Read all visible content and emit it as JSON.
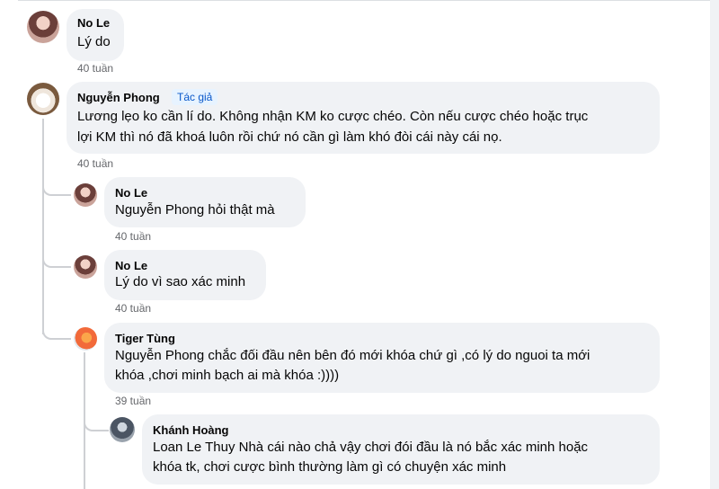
{
  "comments": [
    {
      "name": "No Le",
      "text": [
        "Lý do"
      ],
      "time": "40 tuần"
    },
    {
      "name": "Nguyễn Phong",
      "badge": "Tác giả",
      "text": [
        "Lương lẹo ko cần lí do. Không nhận KM ko cược chéo. Còn nếu cược chéo hoặc trục",
        "lợi KM thì nó đã khoá luôn rồi chứ nó cần gì làm khó đòi cái này cái nọ."
      ],
      "time": "40 tuần"
    },
    {
      "name": "No Le",
      "text": [
        "Nguyễn Phong hỏi thật mà"
      ],
      "time": "40 tuần"
    },
    {
      "name": "No Le",
      "text": [
        "Lý do vì sao xác minh"
      ],
      "time": "40 tuần"
    },
    {
      "name": "Tiger Tùng",
      "text": [
        "Nguyễn Phong chắc đối đầu nên bên đó mới khóa chứ gì ,có lý do nguoi ta mới",
        "khóa ,chơi minh bạch ai mà khóa :))))"
      ],
      "time": "39 tuần"
    },
    {
      "name": "Khánh Hoàng",
      "text": [
        "Loan Le Thuy Nhà cái nào chả vậy chơi đói đầu là nó bắc xác minh hoặc",
        "khóa tk, chơi cược bình thường làm gì có chuyện xác minh"
      ]
    }
  ],
  "colors": {
    "bubble": "#f0f2f5",
    "thread_line": "#ced0d4",
    "author_badge_text": "#0a58ca",
    "author_badge_bg": "#e7f3ff",
    "time": "#65676b"
  }
}
